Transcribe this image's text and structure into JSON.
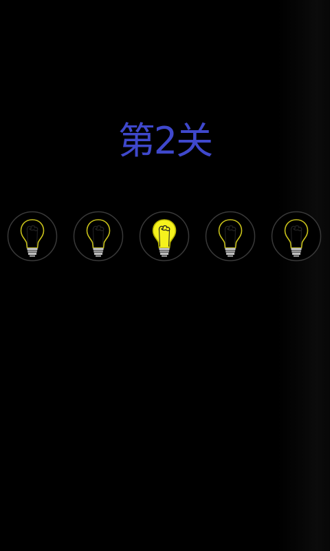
{
  "level": {
    "title": "第2关",
    "title_color": "#3f48cc"
  },
  "bulbs": [
    {
      "state": "off"
    },
    {
      "state": "off"
    },
    {
      "state": "on"
    },
    {
      "state": "off"
    },
    {
      "state": "off"
    }
  ],
  "colors": {
    "bulb_on": "#f5f21d",
    "bulb_off_outline": "#c9c21a",
    "circle_outline": "#3a3a3a",
    "base": "#bfbfbf"
  },
  "icons": {
    "bulb": "lightbulb-icon"
  }
}
